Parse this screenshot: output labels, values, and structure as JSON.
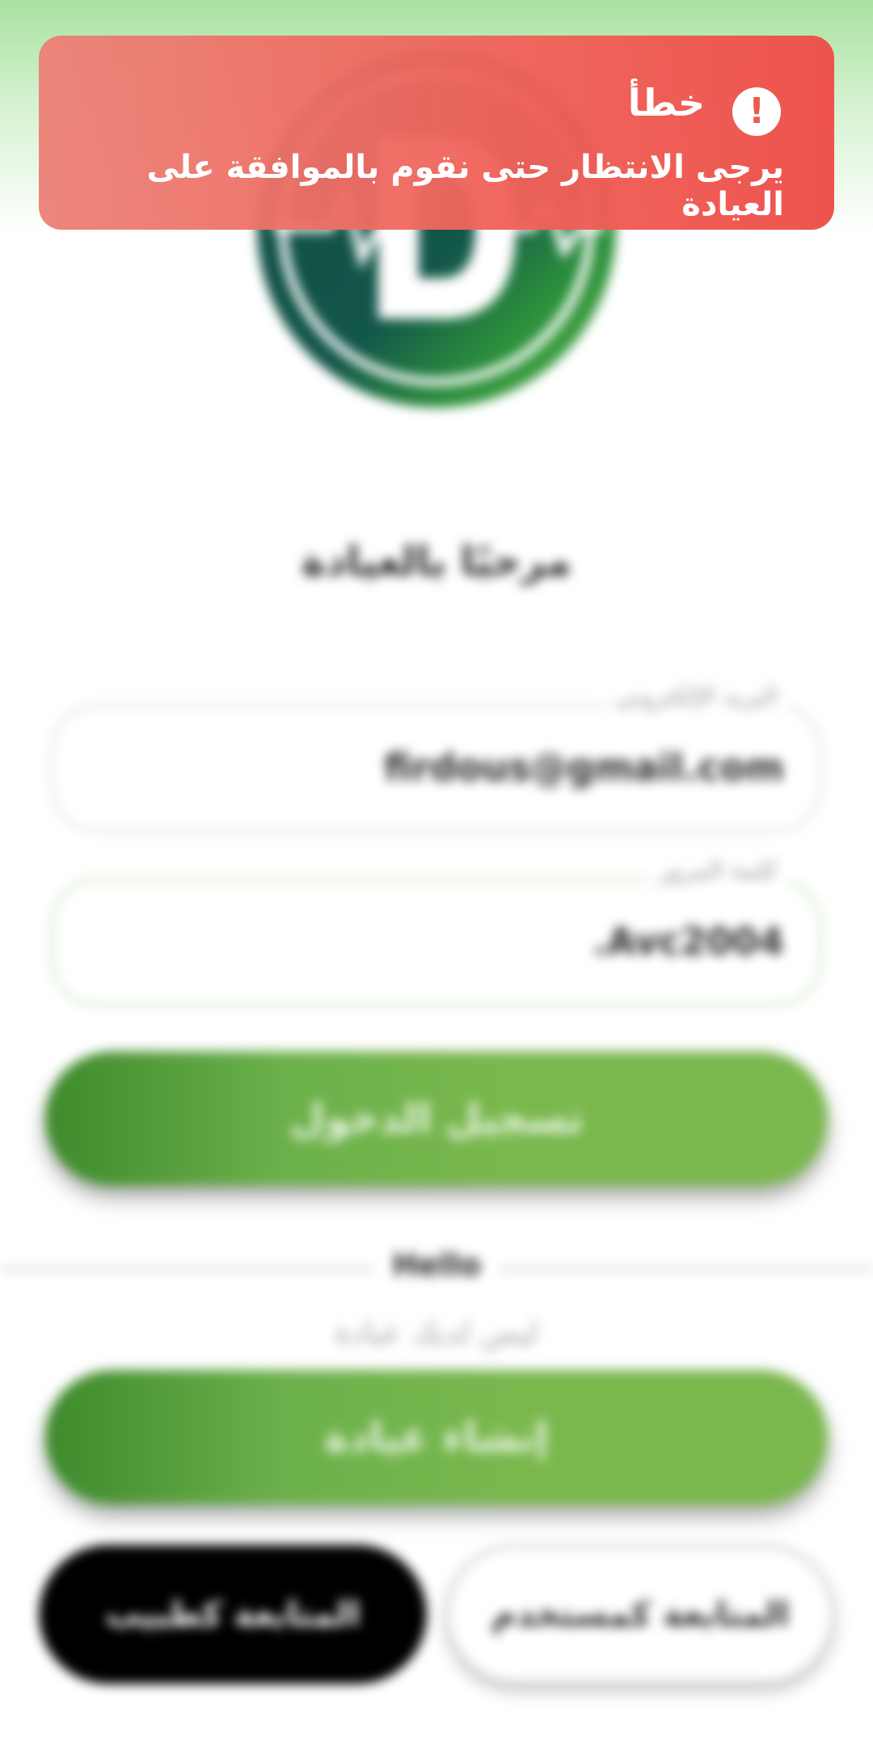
{
  "toast": {
    "title": "خطأ",
    "message": "يرجى الانتظار حتى نقوم بالموافقة على العيادة",
    "icon": "exclamation-icon"
  },
  "logo": {
    "letter": "D"
  },
  "login": {
    "title": "مرحبًا بالعيادة",
    "email": {
      "label": "البريد الإلكتروني",
      "value": "firdous@gmail.com"
    },
    "password": {
      "label": "كلمة المرور",
      "value": ".Avc2004"
    },
    "login_button": "تسجيل الدخول",
    "divider_text": "Hello",
    "no_clinic_text": "ليس لديك عيادة",
    "create_clinic_button": "إنشاء عيادة",
    "continue_doctor_button": "المتابعة كطبيب",
    "continue_user_button": "المتابعة كمستخدم"
  },
  "colors": {
    "accent_green": "#7ab84e",
    "dark_green": "#3e8a2c",
    "logo_dark": "#0f4d43",
    "error_red": "#ee5a52"
  }
}
